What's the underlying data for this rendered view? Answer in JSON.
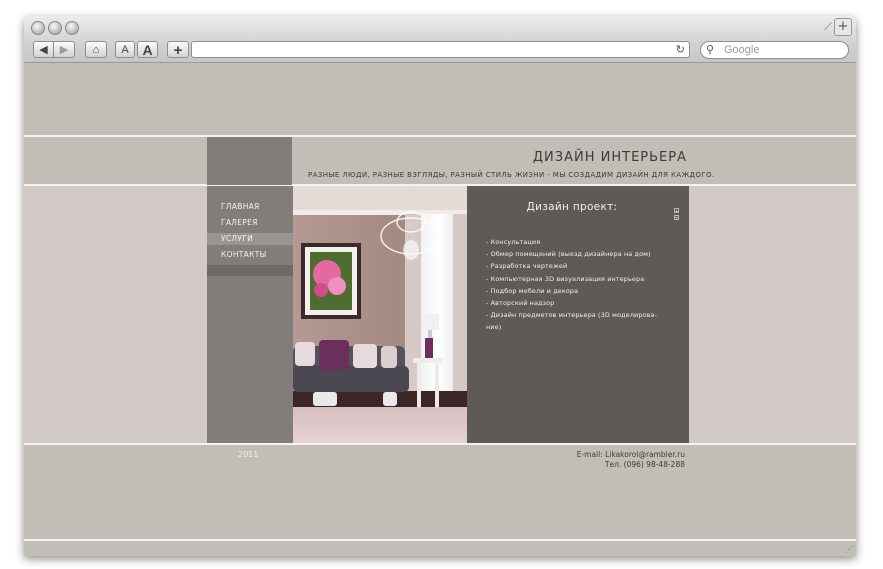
{
  "browser": {
    "search_placeholder": "Google",
    "buttons": {
      "text_smaller": "A",
      "text_bigger": "A",
      "add": "+"
    },
    "icons": {
      "back": "◀",
      "forward": "▶",
      "home": "⌂",
      "reload": "↻",
      "search": "🔍︎",
      "new_tab": "+"
    }
  },
  "site": {
    "title": "ДИЗАЙН ИНТЕРЬЕРА",
    "tagline": "РАЗНЫЕ ЛЮДИ, РАЗНЫЕ  ВЗГЛЯДЫ, РАЗНЫЙ СТИЛЬ ЖИЗНИ - МЫ СОЗДАДИМ ДИЗАЙН ДЛЯ КАЖДОГО."
  },
  "nav": {
    "items": [
      {
        "label": "ГЛАВНАЯ",
        "active": false
      },
      {
        "label": "ГАЛЕРЕЯ",
        "active": false
      },
      {
        "label": "УСЛУГИ",
        "active": true
      },
      {
        "label": "КОНТАКТЫ",
        "active": false
      }
    ]
  },
  "panel": {
    "title": "Дизайн проект:",
    "services": [
      "- Консультация",
      "- Обмер помещений (выезд дизайнера на дом)",
      "- Разработка чертежей",
      "- Компьютерная 3D визуализация интерьера",
      "- Подбор мебели и декора",
      "- Авторский надзор",
      "- Дизайн предметов интерьера (3D моделирова-",
      "ние)"
    ]
  },
  "footer": {
    "year": "2011",
    "email": "E-mail: Likakorol@rambler.ru",
    "phone": "Тел. (096) 98-48-288"
  },
  "colors": {
    "page_bg": "#c3bdb8",
    "mid_band": "#d2cac6",
    "nav_bg": "#827d7a",
    "nav_active": "#9a9592",
    "panel_bg": "#5f5a57",
    "text_dark": "#3f3a37",
    "text_light": "#f2efec"
  }
}
